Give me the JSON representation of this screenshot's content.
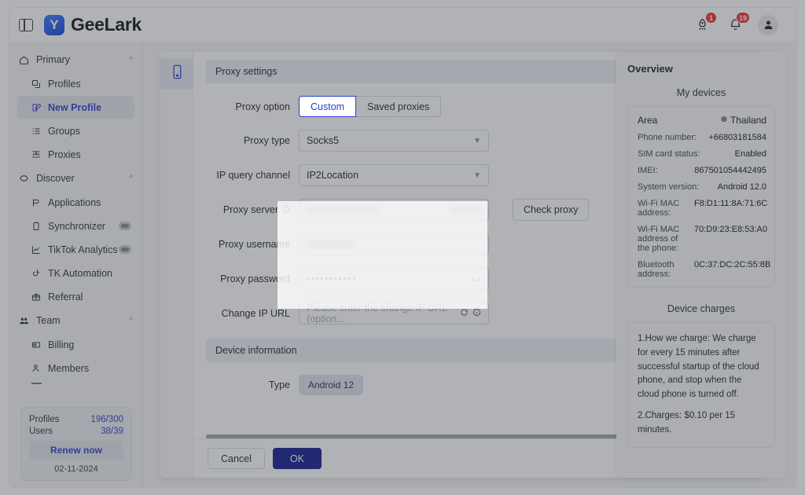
{
  "header": {
    "panel_toggle_icon": "panel-toggle-icon",
    "brand_name": "GeeLark",
    "rocket_badge": "1",
    "bell_badge": "19"
  },
  "sidebar": {
    "groups": [
      {
        "label": "Primary",
        "icon": "home-icon",
        "items": [
          {
            "label": "Profiles",
            "icon": "profiles-icon",
            "active": false,
            "toggle": false
          },
          {
            "label": "New Profile",
            "icon": "new-profile-icon",
            "active": true,
            "toggle": false
          },
          {
            "label": "Groups",
            "icon": "groups-icon",
            "active": false,
            "toggle": false
          },
          {
            "label": "Proxies",
            "icon": "proxies-icon",
            "active": false,
            "toggle": false
          }
        ]
      },
      {
        "label": "Discover",
        "icon": "discover-icon",
        "items": [
          {
            "label": "Applications",
            "icon": "applications-icon",
            "active": false,
            "toggle": false
          },
          {
            "label": "Synchronizer",
            "icon": "synchronizer-icon",
            "active": false,
            "toggle": true
          },
          {
            "label": "TikTok Analytics",
            "icon": "analytics-icon",
            "active": false,
            "toggle": true
          },
          {
            "label": "TK Automation",
            "icon": "tiktok-icon",
            "active": false,
            "toggle": false
          },
          {
            "label": "Referral",
            "icon": "gift-icon",
            "active": false,
            "toggle": false
          }
        ]
      },
      {
        "label": "Team",
        "icon": "team-icon",
        "items": [
          {
            "label": "Billing",
            "icon": "billing-icon",
            "active": false,
            "toggle": false
          },
          {
            "label": "Members",
            "icon": "members-icon",
            "active": false,
            "toggle": false
          }
        ]
      }
    ],
    "plan": {
      "profiles_label": "Profiles",
      "profiles_value": "196/300",
      "users_label": "Users",
      "users_value": "38/39",
      "renew_label": "Renew now",
      "date": "02-11-2024"
    }
  },
  "dialog": {
    "tab_icon": "device-phone-icon",
    "proxy_section": {
      "title": "Proxy settings",
      "collapse_icon": "chevron-up-icon",
      "proxy_option_label": "Proxy option",
      "proxy_option_custom": "Custom",
      "proxy_option_saved": "Saved proxies",
      "proxy_type_label": "Proxy type",
      "proxy_type_value": "Socks5",
      "ip_channel_label": "IP query channel",
      "ip_channel_value": "IP2Location",
      "proxy_server_label": "Proxy server",
      "proxy_server_help_icon": "question-circle-icon",
      "proxy_username_label": "Proxy username",
      "proxy_password_label": "Proxy password",
      "proxy_password_value": "•••••••••••",
      "password_eye_icon": "eye-off-icon",
      "check_proxy_label": "Check proxy",
      "change_ip_label": "Change IP URL",
      "change_ip_placeholder": "Please enter the change IP URL (option...",
      "change_ip_refresh_icon": "refresh-icon",
      "change_ip_info_icon": "info-circle-icon"
    },
    "device_section": {
      "title": "Device information",
      "collapse_icon": "chevron-up-icon",
      "type_label": "Type",
      "type_value": "Android 12"
    },
    "footer": {
      "cancel_label": "Cancel",
      "ok_label": "OK"
    }
  },
  "overview": {
    "title": "Overview",
    "my_devices_label": "My devices",
    "location_icon": "location-pin-icon",
    "rows": [
      {
        "key": "Area",
        "value": "Thailand"
      },
      {
        "key": "Phone number:",
        "value": "+66803181584"
      },
      {
        "key": "SIM card status:",
        "value": "Enabled"
      },
      {
        "key": "IMEI:",
        "value": "867501054442495"
      },
      {
        "key": "System version:",
        "value": "Android 12.0"
      },
      {
        "key": "Wi-Fi MAC address:",
        "value": "F8:D1:11:8A:71:6C"
      },
      {
        "key": "Wi-Fi MAC address of the phone:",
        "value": "70:D9:23:E8:53:A0"
      },
      {
        "key": "Bluetooth address:",
        "value": "0C:37:DC:2C:55:8B"
      }
    ],
    "device_charges_label": "Device charges",
    "notes": [
      "1.How we charge: We charge for every 15 minutes after successful startup of the cloud phone, and stop when the cloud phone is turned off.",
      "2.Charges: $0.10 per 15 minutes."
    ]
  },
  "colors": {
    "accent": "#2a3fd0",
    "primary_button": "#111a8e",
    "badge": "#ee2d2d"
  }
}
